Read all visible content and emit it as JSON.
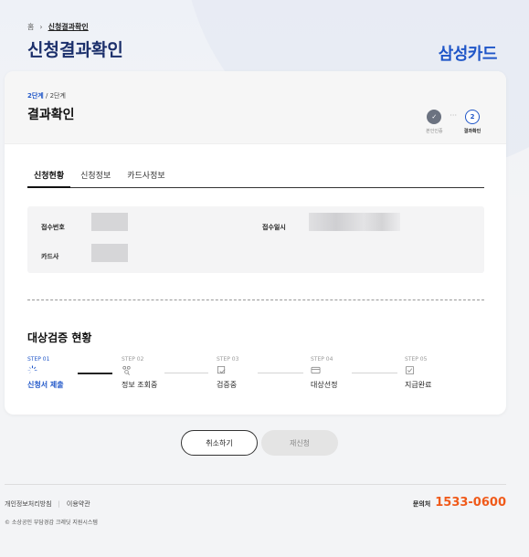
{
  "breadcrumb": {
    "home": "홈",
    "sep": "›",
    "current": "신청결과확인"
  },
  "page_title": "신청결과확인",
  "brand": "삼성카드",
  "card": {
    "step_current": "2단계",
    "step_total": "/ 2단계",
    "title": "결과확인",
    "mini_steps": [
      {
        "num": "✓",
        "label": "본인인증"
      },
      {
        "num": "2",
        "label": "결과확인"
      }
    ],
    "mini_dots": "···",
    "tabs": [
      "신청현황",
      "신청정보",
      "카드사정보"
    ],
    "info": {
      "receipt_no_label": "접수번호",
      "receipt_date_label": "접수일시",
      "card_company_label": "카드사"
    },
    "section_title": "대상검증 현황",
    "steps": [
      {
        "step": "STEP 01",
        "name": "신청서 제출",
        "icon": "spinner-icon"
      },
      {
        "step": "STEP 02",
        "name": "정보 조회중",
        "icon": "people-search-icon"
      },
      {
        "step": "STEP 03",
        "name": "검증중",
        "icon": "document-check-icon"
      },
      {
        "step": "STEP 04",
        "name": "대상선정",
        "icon": "card-icon"
      },
      {
        "step": "STEP 05",
        "name": "지급완료",
        "icon": "checkbox-icon"
      }
    ]
  },
  "buttons": {
    "cancel": "취소하기",
    "reapply": "재신청"
  },
  "footer": {
    "privacy": "개인정보처리방침",
    "sep": "|",
    "terms": "이용약관",
    "copyright": "© 소상공인 부담경감 크레딧 지원시스템",
    "contact_label": "문의처",
    "contact_number": "1533-0600"
  },
  "colors": {
    "primary": "#1f56c8",
    "title": "#1b2f6b",
    "accent": "#f05a1a"
  }
}
